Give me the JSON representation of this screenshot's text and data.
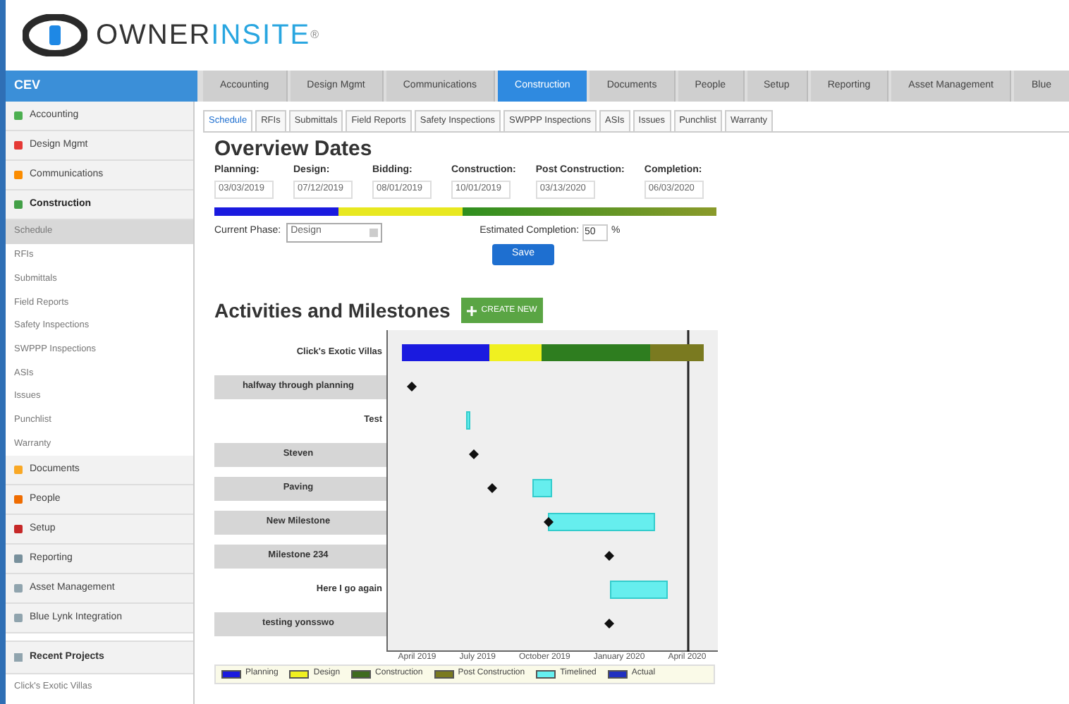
{
  "logo": {
    "part_1": "OWNER",
    "part_2": "INSITE",
    "mark": "®"
  },
  "header": {
    "project": "CEV"
  },
  "main_tabs": [
    {
      "label": "Accounting",
      "selected": false
    },
    {
      "label": "Design Mgmt",
      "selected": false
    },
    {
      "label": "Communications",
      "selected": false
    },
    {
      "label": "Construction",
      "selected": true
    },
    {
      "label": "Documents",
      "selected": false
    },
    {
      "label": "People",
      "selected": false
    },
    {
      "label": "Setup",
      "selected": false
    },
    {
      "label": "Reporting",
      "selected": false
    },
    {
      "label": "Asset Management",
      "selected": false
    },
    {
      "label": "Blue",
      "selected": false
    }
  ],
  "sidebar": {
    "items": [
      {
        "label": "Accounting",
        "color": "#4caf50",
        "expanded": false
      },
      {
        "label": "Design Mgmt",
        "color": "#e53935",
        "expanded": false
      },
      {
        "label": "Communications",
        "color": "#fb8c00",
        "expanded": false
      },
      {
        "label": "Construction",
        "color": "#43a047",
        "expanded": true,
        "children": [
          {
            "label": "Schedule",
            "selected": true
          },
          {
            "label": "RFIs",
            "selected": false
          },
          {
            "label": "Submittals",
            "selected": false
          },
          {
            "label": "Field Reports",
            "selected": false
          },
          {
            "label": "Safety Inspections",
            "selected": false
          },
          {
            "label": "SWPPP Inspections",
            "selected": false
          },
          {
            "label": "ASIs",
            "selected": false
          },
          {
            "label": "Issues",
            "selected": false
          },
          {
            "label": "Punchlist",
            "selected": false
          },
          {
            "label": "Warranty",
            "selected": false
          }
        ]
      },
      {
        "label": "Documents",
        "color": "#f9a825",
        "expanded": false
      },
      {
        "label": "People",
        "color": "#ef6c00",
        "expanded": false
      },
      {
        "label": "Setup",
        "color": "#c62828",
        "expanded": false
      },
      {
        "label": "Reporting",
        "color": "#78909c",
        "expanded": false
      },
      {
        "label": "Asset Management",
        "color": "#90a4ae",
        "expanded": false
      },
      {
        "label": "Blue Lynk Integration",
        "color": "#90a4ae",
        "expanded": false
      }
    ],
    "recent": {
      "title": "Recent Projects",
      "items": [
        "Click's Exotic Villas"
      ]
    }
  },
  "sub_tabs": [
    {
      "label": "Schedule",
      "selected": true
    },
    {
      "label": "RFIs",
      "selected": false
    },
    {
      "label": "Submittals",
      "selected": false
    },
    {
      "label": "Field Reports",
      "selected": false
    },
    {
      "label": "Safety Inspections",
      "selected": false
    },
    {
      "label": "SWPPP Inspections",
      "selected": false
    },
    {
      "label": "ASIs",
      "selected": false
    },
    {
      "label": "Issues",
      "selected": false
    },
    {
      "label": "Punchlist",
      "selected": false
    },
    {
      "label": "Warranty",
      "selected": false
    }
  ],
  "overview": {
    "title": "Overview Dates",
    "dates": [
      {
        "label": "Planning:",
        "value": "03/03/2019"
      },
      {
        "label": "Design:",
        "value": "07/12/2019"
      },
      {
        "label": "Bidding:",
        "value": "08/01/2019"
      },
      {
        "label": "Construction:",
        "value": "10/01/2019"
      },
      {
        "label": "Post Construction:",
        "value": "03/13/2020"
      },
      {
        "label": "Completion:",
        "value": "06/03/2020"
      }
    ],
    "current_phase": {
      "label": "Current Phase:",
      "value": "Design"
    },
    "estimated_completion": {
      "label": "Estimated Completion:",
      "value": "50",
      "unit": "%"
    },
    "save": "Save"
  },
  "activities": {
    "title": "Activities and Milestones",
    "create": "CREATE NEW",
    "rows": [
      {
        "label": "Click's Exotic Villas",
        "kind": "project"
      },
      {
        "label": "halfway through planning",
        "kind": "milestone"
      },
      {
        "label": "Test",
        "kind": "task"
      },
      {
        "label": "Steven",
        "kind": "milestone"
      },
      {
        "label": "Paving",
        "kind": "milestone"
      },
      {
        "label": "New Milestone",
        "kind": "milestone"
      },
      {
        "label": "Milestone 234",
        "kind": "milestone"
      },
      {
        "label": "Here I go again",
        "kind": "task"
      },
      {
        "label": "testing yonsswo",
        "kind": "milestone"
      }
    ],
    "axis": [
      "April 2019",
      "July 2019",
      "October 2019",
      "January 2020",
      "April 2020"
    ],
    "legend": [
      {
        "label": "Planning",
        "color": "#1a1adf"
      },
      {
        "label": "Design",
        "color": "#f0f020"
      },
      {
        "label": "Construction",
        "color": "#3f6b1f"
      },
      {
        "label": "Post Construction",
        "color": "#7a7a20"
      },
      {
        "label": "Timelined",
        "color": "#66f0f0"
      },
      {
        "label": "Actual",
        "color": "#2030c0"
      }
    ]
  }
}
